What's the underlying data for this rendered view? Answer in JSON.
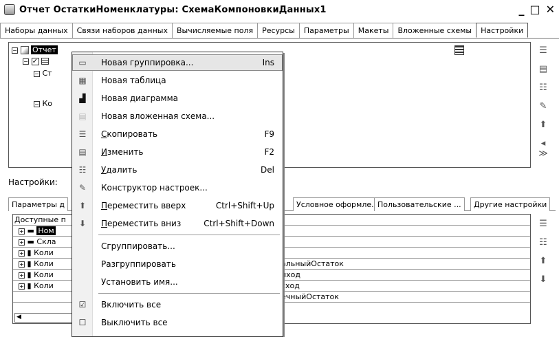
{
  "window": {
    "title": "Отчет ОстаткиНоменклатуры: СхемаКомпоновкиДанных1",
    "buttons": [
      "_",
      "□",
      "✕"
    ]
  },
  "tabs": [
    {
      "label": "Наборы данных"
    },
    {
      "label": "Связи наборов данных"
    },
    {
      "label": "Вычисляемые поля"
    },
    {
      "label": "Ресурсы"
    },
    {
      "label": "Параметры"
    },
    {
      "label": "Макеты"
    },
    {
      "label": "Вложенные схемы"
    },
    {
      "label": "Настройки",
      "active": true
    }
  ],
  "tree": {
    "root": "Отчет",
    "items": [
      {
        "prefix": "Ст"
      },
      {
        "prefix": "Ко"
      }
    ]
  },
  "settings": {
    "label": "Настройки:"
  },
  "subtabs": [
    {
      "label": "Параметры д"
    },
    {
      "label": "Условное оформле..."
    },
    {
      "label": "Пользовательские ..."
    },
    {
      "label": "Другие настройки"
    }
  ],
  "grid": {
    "header": "Доступные п",
    "rows": [
      {
        "left": "Ном",
        "right": ""
      },
      {
        "left": "Скла",
        "right": ""
      },
      {
        "left": "Коли",
        "right": ""
      },
      {
        "left": "Коли",
        "right": "альныйОстаток"
      },
      {
        "left": "Коли",
        "right": "иход"
      },
      {
        "left": "Коли",
        "right": "сход"
      },
      {
        "left": "",
        "right": "ечныйОстаток"
      }
    ]
  },
  "context_menu": {
    "items": [
      {
        "label": "Новая группировка...",
        "shortcut": "Ins",
        "icon": "new-grouping-icon",
        "highlighted": true
      },
      {
        "label": "Новая таблица",
        "shortcut": "",
        "icon": "new-table-icon"
      },
      {
        "label": "Новая диаграмма",
        "shortcut": "",
        "icon": "new-chart-icon"
      },
      {
        "label": "Новая вложенная схема...",
        "shortcut": "",
        "icon": "nested-schema-icon"
      },
      {
        "label": "Скопировать",
        "shortcut": "F9",
        "icon": "copy-icon",
        "u": "С"
      },
      {
        "label": "Изменить",
        "shortcut": "F2",
        "icon": "edit-icon",
        "u": "И"
      },
      {
        "label": "Удалить",
        "shortcut": "Del",
        "icon": "delete-icon",
        "u": "У"
      },
      {
        "label": "Конструктор настроек...",
        "shortcut": "",
        "icon": "wizard-icon"
      },
      {
        "label": "Переместить вверх",
        "shortcut": "Ctrl+Shift+Up",
        "icon": "arrow-up-icon",
        "u": "П"
      },
      {
        "label": "Переместить вниз",
        "shortcut": "Ctrl+Shift+Down",
        "icon": "arrow-down-icon",
        "u": "П"
      },
      {
        "label": "Сгруппировать...",
        "shortcut": ""
      },
      {
        "label": "Разгруппировать",
        "shortcut": ""
      },
      {
        "label": "Установить имя...",
        "shortcut": ""
      },
      {
        "label": "Включить все",
        "shortcut": "",
        "icon": "check-all-icon"
      },
      {
        "label": "Выключить все",
        "shortcut": "",
        "icon": "uncheck-all-icon"
      }
    ]
  }
}
